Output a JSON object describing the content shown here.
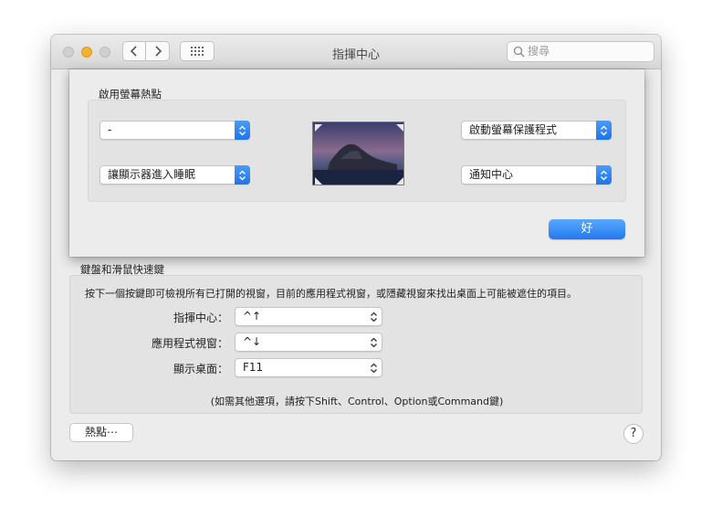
{
  "window": {
    "title": "指揮中心"
  },
  "search": {
    "placeholder": "搜尋"
  },
  "sheet": {
    "section_label": "啟用螢幕熱點",
    "corners": {
      "top_left": "-",
      "top_right": "啟動螢幕保護程式",
      "bottom_left": "讓顯示器進入睡眠",
      "bottom_right": "通知中心"
    },
    "ok_label": "好"
  },
  "shortcuts": {
    "section_label": "鍵盤和滑鼠快速鍵",
    "description": "按下一個按鍵即可檢視所有已打開的視窗，目前的應用程式視窗，或隱藏視窗來找出桌面上可能被遮住的項目。",
    "rows": [
      {
        "label": "指揮中心：",
        "value": "^↑"
      },
      {
        "label": "應用程式視窗：",
        "value": "^↓"
      },
      {
        "label": "顯示桌面：",
        "value": "F11"
      }
    ],
    "hint": "(如需其他選項，請按下Shift、Control、Option或Command鍵)"
  },
  "footer": {
    "hot_corners_label": "熱點⋯",
    "help_label": "?"
  },
  "colors": {
    "accent": "#2b7ff3",
    "traffic_min": "#f5b132"
  },
  "icons": [
    "chevron-left-icon",
    "chevron-right-icon",
    "grid-icon",
    "search-icon",
    "up-down-chevron-icon"
  ]
}
